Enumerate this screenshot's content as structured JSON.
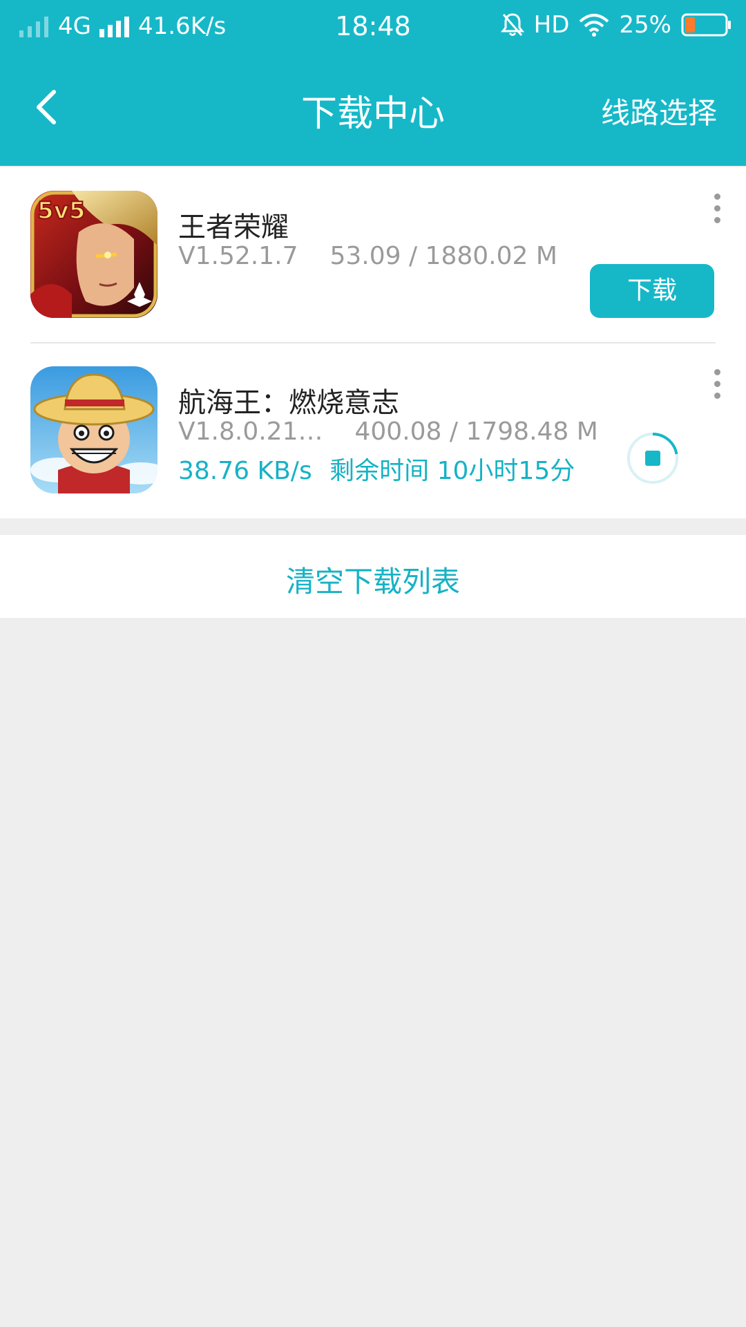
{
  "status_bar": {
    "network_type": "4G",
    "net_speed": "41.6K/s",
    "time": "18:48",
    "hd_label": "HD",
    "battery_percent": "25%",
    "battery_level": 0.25
  },
  "header": {
    "title": "下载中心",
    "right_action": "线路选择"
  },
  "downloads": [
    {
      "name": "王者荣耀",
      "version": "V1.52.1.7",
      "size": "53.09 / 1880.02 M",
      "action_label": "下载"
    },
    {
      "name": "航海王：燃烧意志",
      "version": "V1.8.0.21…",
      "size": "400.08 / 1798.48 M",
      "speed": "38.76 KB/s",
      "remaining": "剩余时间 10小时15分",
      "progress": 0.2225
    }
  ],
  "clear_label": "清空下载列表",
  "colors": {
    "accent": "#16b8c8",
    "background": "#eeeeee",
    "text_gray": "#9a9a9a"
  }
}
